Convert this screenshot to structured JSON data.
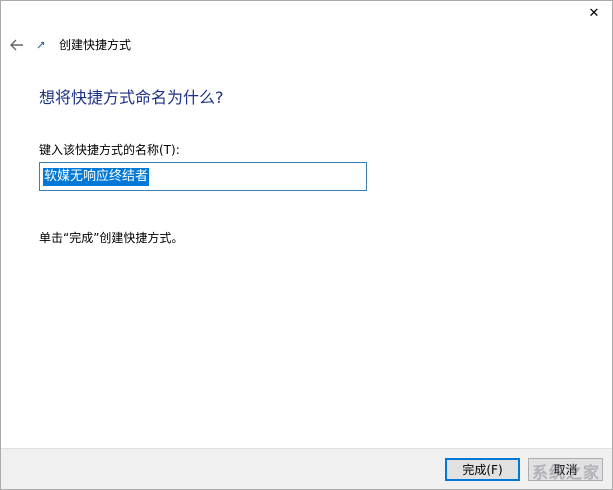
{
  "window": {
    "close_glyph": "✕"
  },
  "nav": {
    "back_glyph": "←",
    "icon": "shortcut-wizard-icon",
    "title": "创建快捷方式"
  },
  "main": {
    "heading": "想将快捷方式命名为什么?",
    "name_label": "键入该快捷方式的名称(T):",
    "name_value": "软媒无响应终结者",
    "hint": "单击“完成”创建快捷方式。"
  },
  "footer": {
    "finish_label": "完成(F)",
    "cancel_label": "取消"
  },
  "watermark": {
    "text": "系统之家"
  },
  "colors": {
    "heading": "#1e3287",
    "selection": "#0078d7",
    "input_border": "#3c7fb1",
    "footer_bg": "#f0f0f0"
  }
}
